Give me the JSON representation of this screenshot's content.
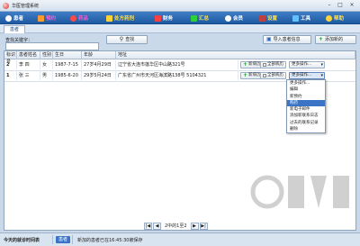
{
  "window": {
    "title": "华医管理系统",
    "minimize": "–",
    "maximize": "□",
    "close": "×"
  },
  "menu": [
    {
      "label": "患者",
      "color": "#ffffff",
      "icon": "patient-icon",
      "icon_color": "#ffffff"
    },
    {
      "label": "预约",
      "color": "#ff5ad0",
      "icon": "calendar-icon",
      "icon_color": "#ff9a2e"
    },
    {
      "label": "药品",
      "color": "#ff5ad0",
      "icon": "pill-icon",
      "icon_color": "#ff4a4a"
    },
    {
      "label": "处方药剂",
      "color": "#ffe14d",
      "icon": "prescription-icon",
      "icon_color": "#ffd23a"
    },
    {
      "label": "财务",
      "color": "#ffffff",
      "icon": "money-icon",
      "icon_color": "#ff4040"
    },
    {
      "label": "汇总",
      "color": "#ffe14d",
      "icon": "chart-icon",
      "icon_color": "#2fcf3a"
    },
    {
      "label": "会员",
      "color": "#ffffff",
      "icon": "member-icon",
      "icon_color": "#ffffff"
    },
    {
      "label": "设置",
      "color": "#ffe14d",
      "icon": "wrench-icon",
      "icon_color": "#c04040"
    },
    {
      "label": "工具",
      "color": "#ffffff",
      "icon": "tools-icon",
      "icon_color": "#5fc2ff"
    },
    {
      "label": "帮助",
      "color": "#ffe14d",
      "icon": "help-icon",
      "icon_color": "#ffd23a"
    }
  ],
  "tab": "患者",
  "search": {
    "label": "查找关键字：",
    "value": "",
    "button": "查找"
  },
  "toolbar": {
    "import": "导入患者信息",
    "add": "添加新的"
  },
  "table": {
    "headers": [
      "标识号",
      "患者姓名",
      "性别",
      "生日",
      "年龄",
      "地址"
    ],
    "rows": [
      {
        "id": "2",
        "name": "李 四",
        "sex": "女",
        "birthday": "1987-7-15",
        "age": "27岁4月29日",
        "address": "辽宁省大连市莲华区中山路321号"
      },
      {
        "id": "1",
        "name": "张 三",
        "sex": "男",
        "birthday": "1985-6-20",
        "age": "29岁5月24日",
        "address": "广东省广州市天河区海滨路138号 5104321"
      }
    ],
    "btn_new_record": "新病历",
    "btn_all_records": "全部病历",
    "btn_more": "更多操作..."
  },
  "dropdown": {
    "items": [
      "更多操作...",
      "编辑",
      "新预约",
      "购药",
      "新电子邮件",
      "添加新联系日志",
      "过去的联系记录",
      "删除"
    ],
    "selected_index": 3
  },
  "pager": {
    "first": "|◀",
    "prev": "◀",
    "info": "2中的1至2",
    "next": "▶",
    "last": "▶|"
  },
  "status": {
    "today_label": "今天的就诊时间表",
    "patient_pill": "患者",
    "message": "新加的患者已在16:45:30被保存"
  }
}
